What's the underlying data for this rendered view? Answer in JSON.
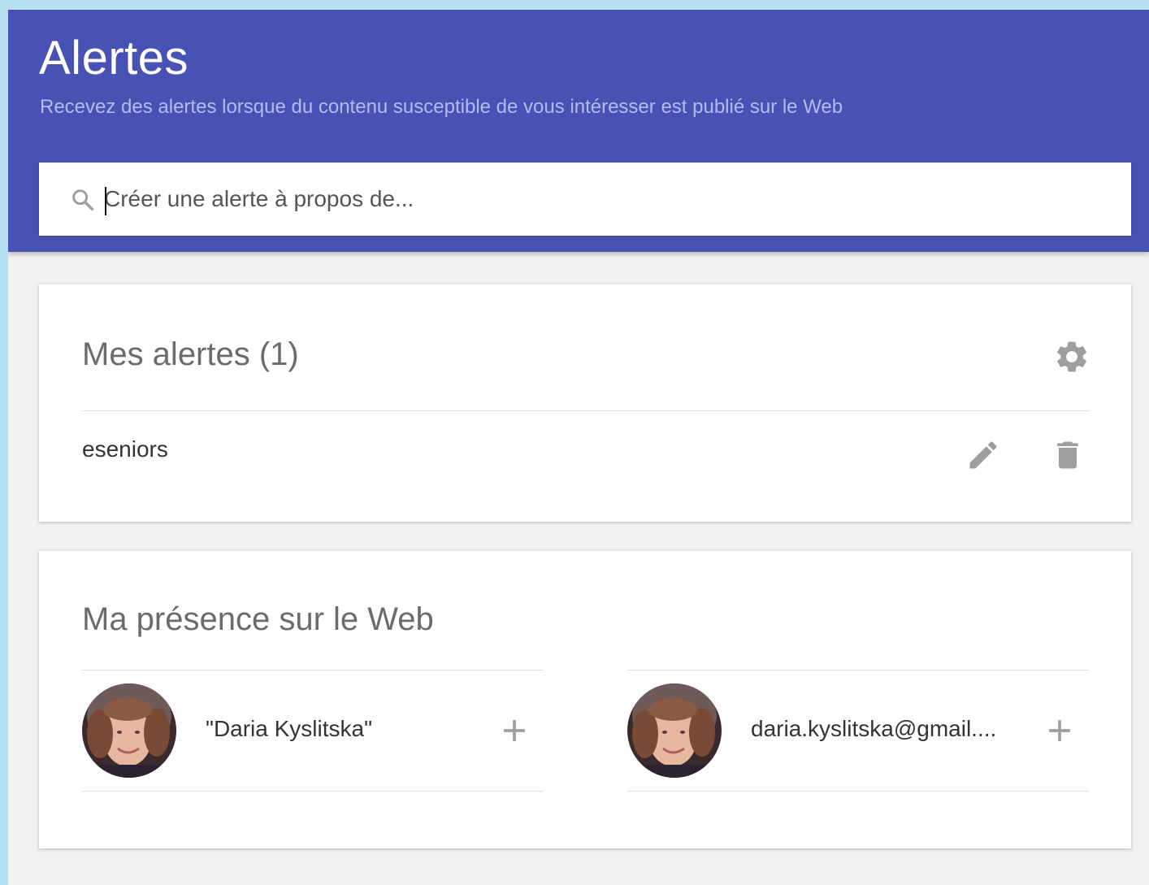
{
  "header": {
    "title": "Alertes",
    "subtitle": "Recevez des alertes lorsque du contenu susceptible de vous intéresser est publié sur le Web"
  },
  "search": {
    "placeholder": "Créer une alerte à propos de..."
  },
  "alerts_card": {
    "title": "Mes alertes (1)",
    "items": [
      {
        "query": "eseniors"
      }
    ]
  },
  "presence_card": {
    "title": "Ma présence sur le Web",
    "items": [
      {
        "label": "\"Daria Kyslitska\""
      },
      {
        "label": "daria.kyslitska@gmail...."
      }
    ]
  },
  "colors": {
    "header_bg": "#4852b4",
    "subtitle": "#b3bbf0",
    "page_bg": "#f1f1f1",
    "outer_bg": "#b6e0f2",
    "icon_gray": "#9e9e9e"
  },
  "icons": {
    "search": "search-icon",
    "settings": "gear-icon",
    "edit": "pencil-icon",
    "delete": "trash-icon",
    "add": "plus-icon"
  }
}
